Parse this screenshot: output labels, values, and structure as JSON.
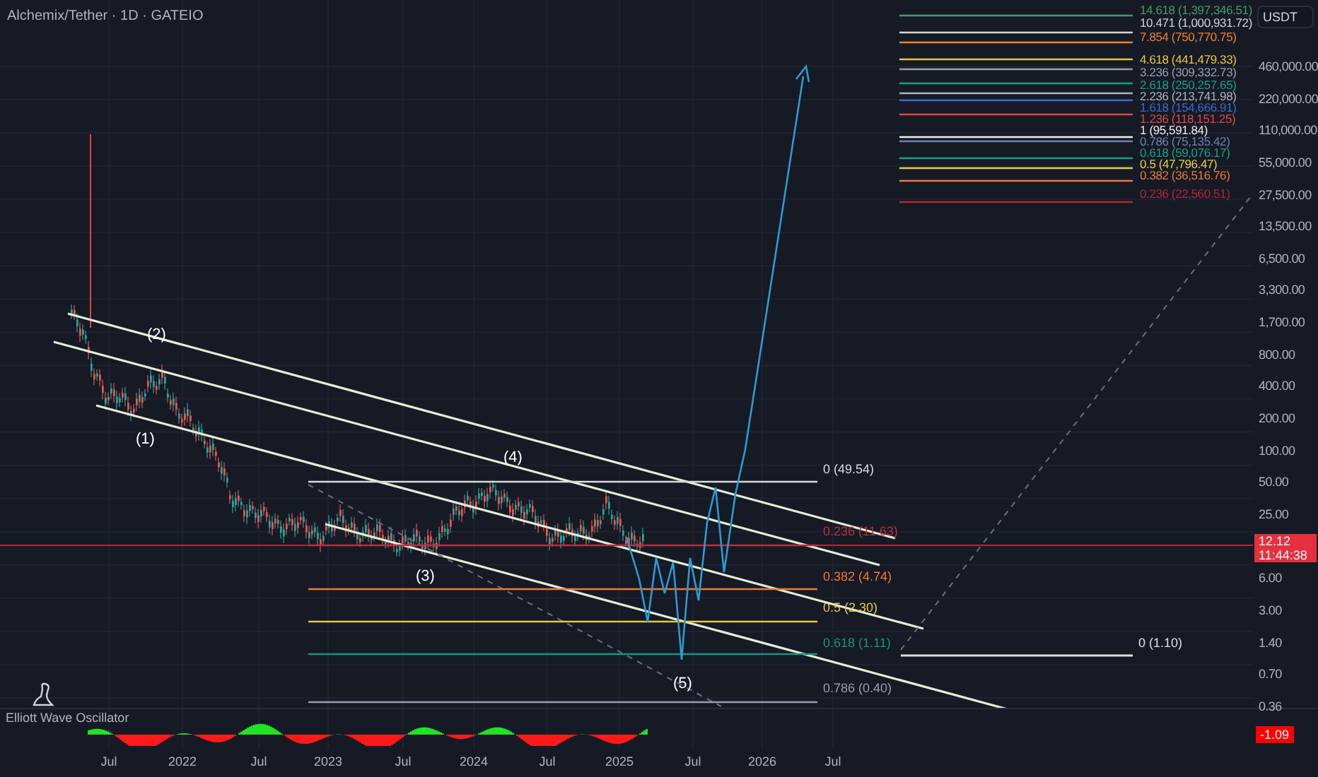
{
  "header": {
    "title": "Alchemix/Tether · 1D · GATEIO"
  },
  "currency_button": {
    "label": "USDT"
  },
  "price_axis": {
    "ticks": [
      "460,000.00",
      "220,000.00",
      "110,000.00",
      "55,000.00",
      "27,500.00",
      "13,500.00",
      "6,500.00",
      "3,300.00",
      "1,700.00",
      "800.00",
      "400.00",
      "200.00",
      "100.00",
      "50.00",
      "25.00",
      "6.00",
      "3.00",
      "1.40",
      "0.70",
      "0.36"
    ],
    "last_price": "12.12",
    "countdown": "11:44:38"
  },
  "chart": {
    "wave_labels": [
      "(2)",
      "(1)",
      "(3)",
      "(4)",
      "(5)"
    ],
    "fib_extension": [
      {
        "label": "14.618 (1,397,346.51)",
        "color": "#4a9a6a"
      },
      {
        "label": "10.471 (1,000,931.72)",
        "color": "#d0d4dc"
      },
      {
        "label": "7.854 (750,770.75)",
        "color": "#f08030"
      },
      {
        "label": "4.618 (441,479.33)",
        "color": "#e8c840"
      },
      {
        "label": "3.236 (309,332.73)",
        "color": "#9aa0b0"
      },
      {
        "label": "2.618 (250,257.65)",
        "color": "#1e9e8a"
      },
      {
        "label": "2.236 (213,741.98)",
        "color": "#b0b4c0"
      },
      {
        "label": "1.618 (154,666.91)",
        "color": "#3c6ad0"
      },
      {
        "label": "1.236 (118,151.25)",
        "color": "#e04848"
      },
      {
        "label": "1 (95,591.84)",
        "color": "#eeeeee"
      },
      {
        "label": "0.786 (75,135.42)",
        "color": "#7080b8"
      },
      {
        "label": "0.618 (59,076.17)",
        "color": "#18a086"
      },
      {
        "label": "0.5 (47,796.47)",
        "color": "#e8d040"
      },
      {
        "label": "0.382 (36,516.76)",
        "color": "#f07838"
      },
      {
        "label": "0.236 (22,560.51)",
        "color": "#b02838"
      }
    ],
    "fib_retracement": [
      {
        "label": "0 (49.54)",
        "color": "#d8dce0"
      },
      {
        "label": "0.236 (11.63)",
        "color": "#b83040"
      },
      {
        "label": "0.382 (4.74)",
        "color": "#f07838"
      },
      {
        "label": "0.5 (2.30)",
        "color": "#e8c840"
      },
      {
        "label": "0.618 (1.11)",
        "color": "#169580"
      },
      {
        "label": "0.786 (0.40)",
        "color": "#9a9cb0"
      }
    ],
    "target_level": {
      "label": "0 (1.10)",
      "color": "#e0e0e0"
    }
  },
  "oscillator": {
    "name": "Elliott Wave Oscillator",
    "value": "-1.09"
  },
  "time_axis": {
    "ticks": [
      "Jul",
      "2022",
      "Jul",
      "2023",
      "Jul",
      "2024",
      "Jul",
      "2025",
      "Jul",
      "2026",
      "Jul"
    ]
  }
}
